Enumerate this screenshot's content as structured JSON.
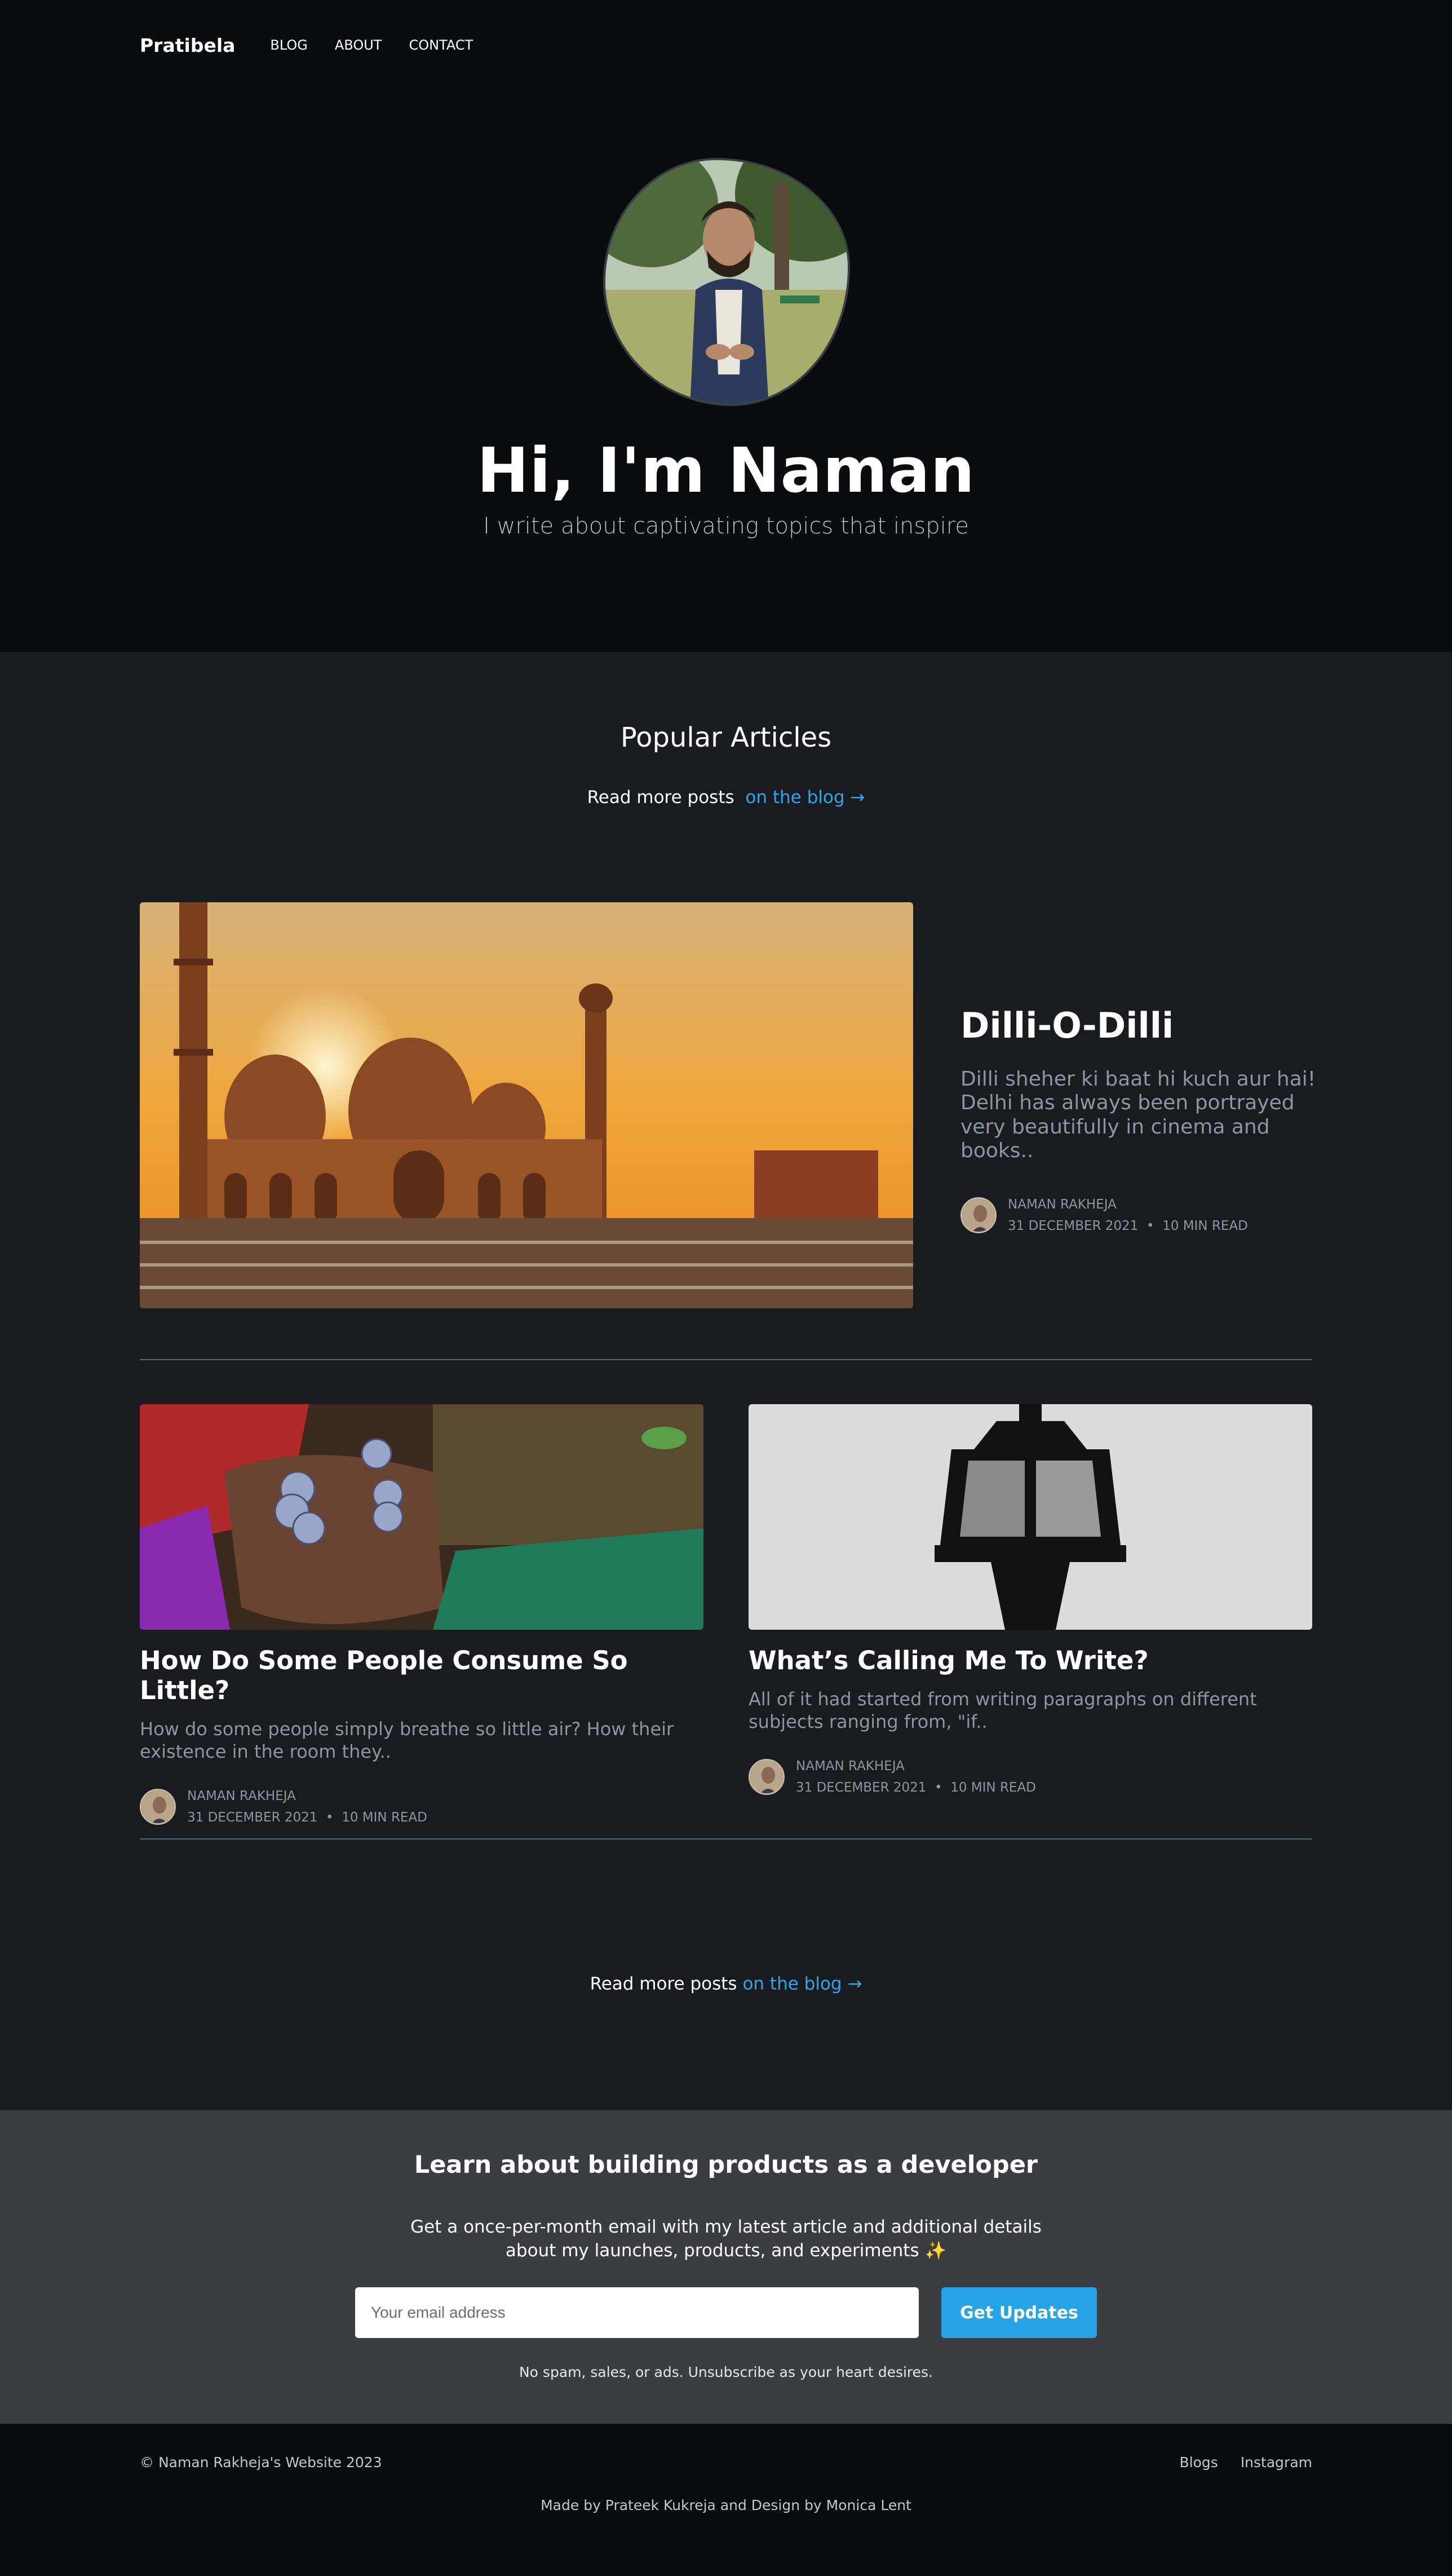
{
  "nav": {
    "brand": "Pratibela",
    "links": [
      "BLOG",
      "ABOUT",
      "CONTACT"
    ]
  },
  "hero": {
    "title": "Hi, I'm Naman",
    "subtitle": "I write about captivating topics that inspire"
  },
  "popular": {
    "title": "Popular Articles",
    "readmore_text": "Read more posts",
    "readmore_link": "on the blog →"
  },
  "featured": {
    "title": "Dilli-O-Dilli",
    "excerpt": "Dilli sheher ki baat hi kuch aur hai! Delhi has always been portrayed very beautifully in cinema and books..",
    "author": "NAMAN RAKHEJA",
    "date": "31 DECEMBER 2021",
    "read": "10 MIN READ"
  },
  "cards": [
    {
      "title": "How Do Some People Consume So Little?",
      "excerpt": "How do some people simply breathe so little air? How their existence in the room they..",
      "author": "NAMAN RAKHEJA",
      "date": "31 DECEMBER 2021",
      "read": "10 MIN READ"
    },
    {
      "title": "What’s Calling Me To Write?",
      "excerpt": "All of it had started from writing paragraphs on different subjects ranging from, \"if..",
      "author": "NAMAN RAKHEJA",
      "date": "31 DECEMBER 2021",
      "read": "10 MIN READ"
    }
  ],
  "bottom_readmore": {
    "text": "Read more posts",
    "link": "on the blog →"
  },
  "newsletter": {
    "title": "Learn about building products as a developer",
    "desc": "Get a once-per-month email with my latest article and additional details about my launches, products, and experiments ✨",
    "placeholder": "Your email address",
    "button": "Get Updates",
    "note": "No spam, sales, or ads. Unsubscribe as your heart desires."
  },
  "footer": {
    "copyright": "© Naman Rakheja's Website 2023",
    "links": [
      "Blogs",
      "Instagram"
    ],
    "credit": "Made by Prateek Kukreja and Design by Monica Lent"
  },
  "colors": {
    "accent": "#2aa8ee",
    "button": "#27a3e7",
    "background": "#1a1b1f",
    "newsletter_bg": "#3c3d41"
  }
}
